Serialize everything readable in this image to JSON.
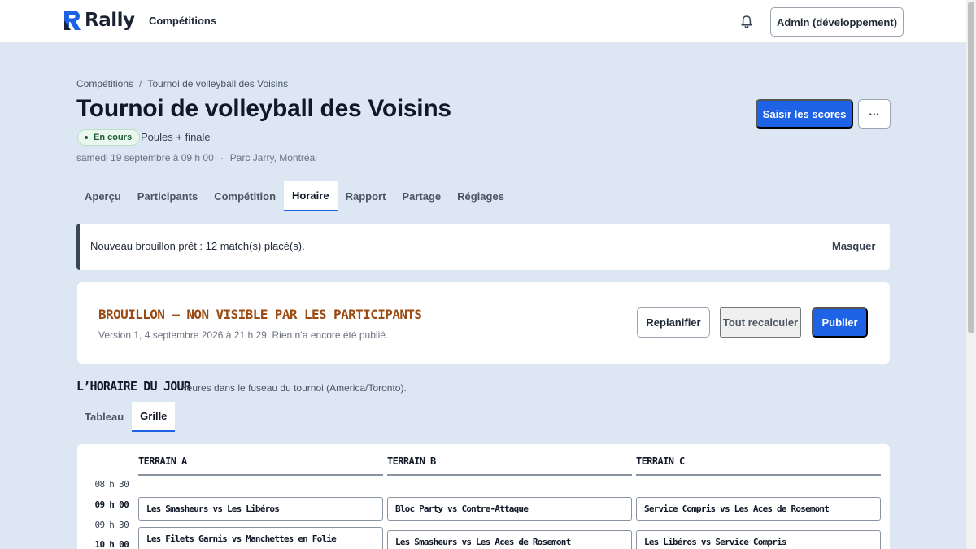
{
  "topbar": {
    "logo_text": "Rally",
    "nav_link": "Compétitions",
    "user_button": "Admin (développement)"
  },
  "breadcrumb": {
    "root": "Compétitions",
    "separator": "/",
    "current": "Tournoi de volleyball des Voisins"
  },
  "header": {
    "title": "Tournoi de volleyball des Voisins",
    "status": "En cours",
    "format": "Poules + finale",
    "date": "samedi 19 septembre à 09 h 00",
    "meta_separator": "·",
    "location": "Parc Jarry, Montréal",
    "primary_action": "Saisir les scores",
    "more_action": "···"
  },
  "tabs": [
    {
      "label": "Aperçu",
      "active": false
    },
    {
      "label": "Participants",
      "active": false
    },
    {
      "label": "Compétition",
      "active": false
    },
    {
      "label": "Horaire",
      "active": true
    },
    {
      "label": "Rapport",
      "active": false
    },
    {
      "label": "Partage",
      "active": false
    },
    {
      "label": "Réglages",
      "active": false
    }
  ],
  "notice": {
    "text": "Nouveau brouillon prêt : 12 match(s) placé(s).",
    "dismiss": "Masquer"
  },
  "draft": {
    "title": "BROUILLON — NON VISIBLE PAR LES PARTICIPANTS",
    "subtitle": "Version 1, 4 septembre 2026 à 21 h 29. Rien n’a encore été publié.",
    "replan": "Replanifier",
    "recalc": "Tout recalculer",
    "publish": "Publier"
  },
  "schedule": {
    "heading": "L’HORAIRE DU JOUR",
    "subheading": "Heures dans le fuseau du tournoi (America/Toronto).",
    "views": [
      {
        "label": "Tableau",
        "active": false
      },
      {
        "label": "Grille",
        "active": true
      }
    ],
    "courts": [
      "TERRAIN A",
      "TERRAIN B",
      "TERRAIN C"
    ],
    "times": [
      "08 h 30",
      "09 h 00",
      "09 h 30",
      "10 h 00"
    ],
    "matches": {
      "a1": "Les Smasheurs vs Les Libéros",
      "a2": "Les Filets Garnis vs Manchettes en Folie",
      "b1": "Bloc Party vs Contre-Attaque",
      "b2": "Les Smasheurs vs Les Aces de Rosemont",
      "c1": "Service Compris vs Les Aces de Rosemont",
      "c2": "Les Libéros vs Service Compris"
    }
  },
  "colors": {
    "accent": "#1e63e6",
    "page_bg": "#dde7f3",
    "draft_title": "#9a4a12",
    "status_green": "#1b5e32"
  }
}
